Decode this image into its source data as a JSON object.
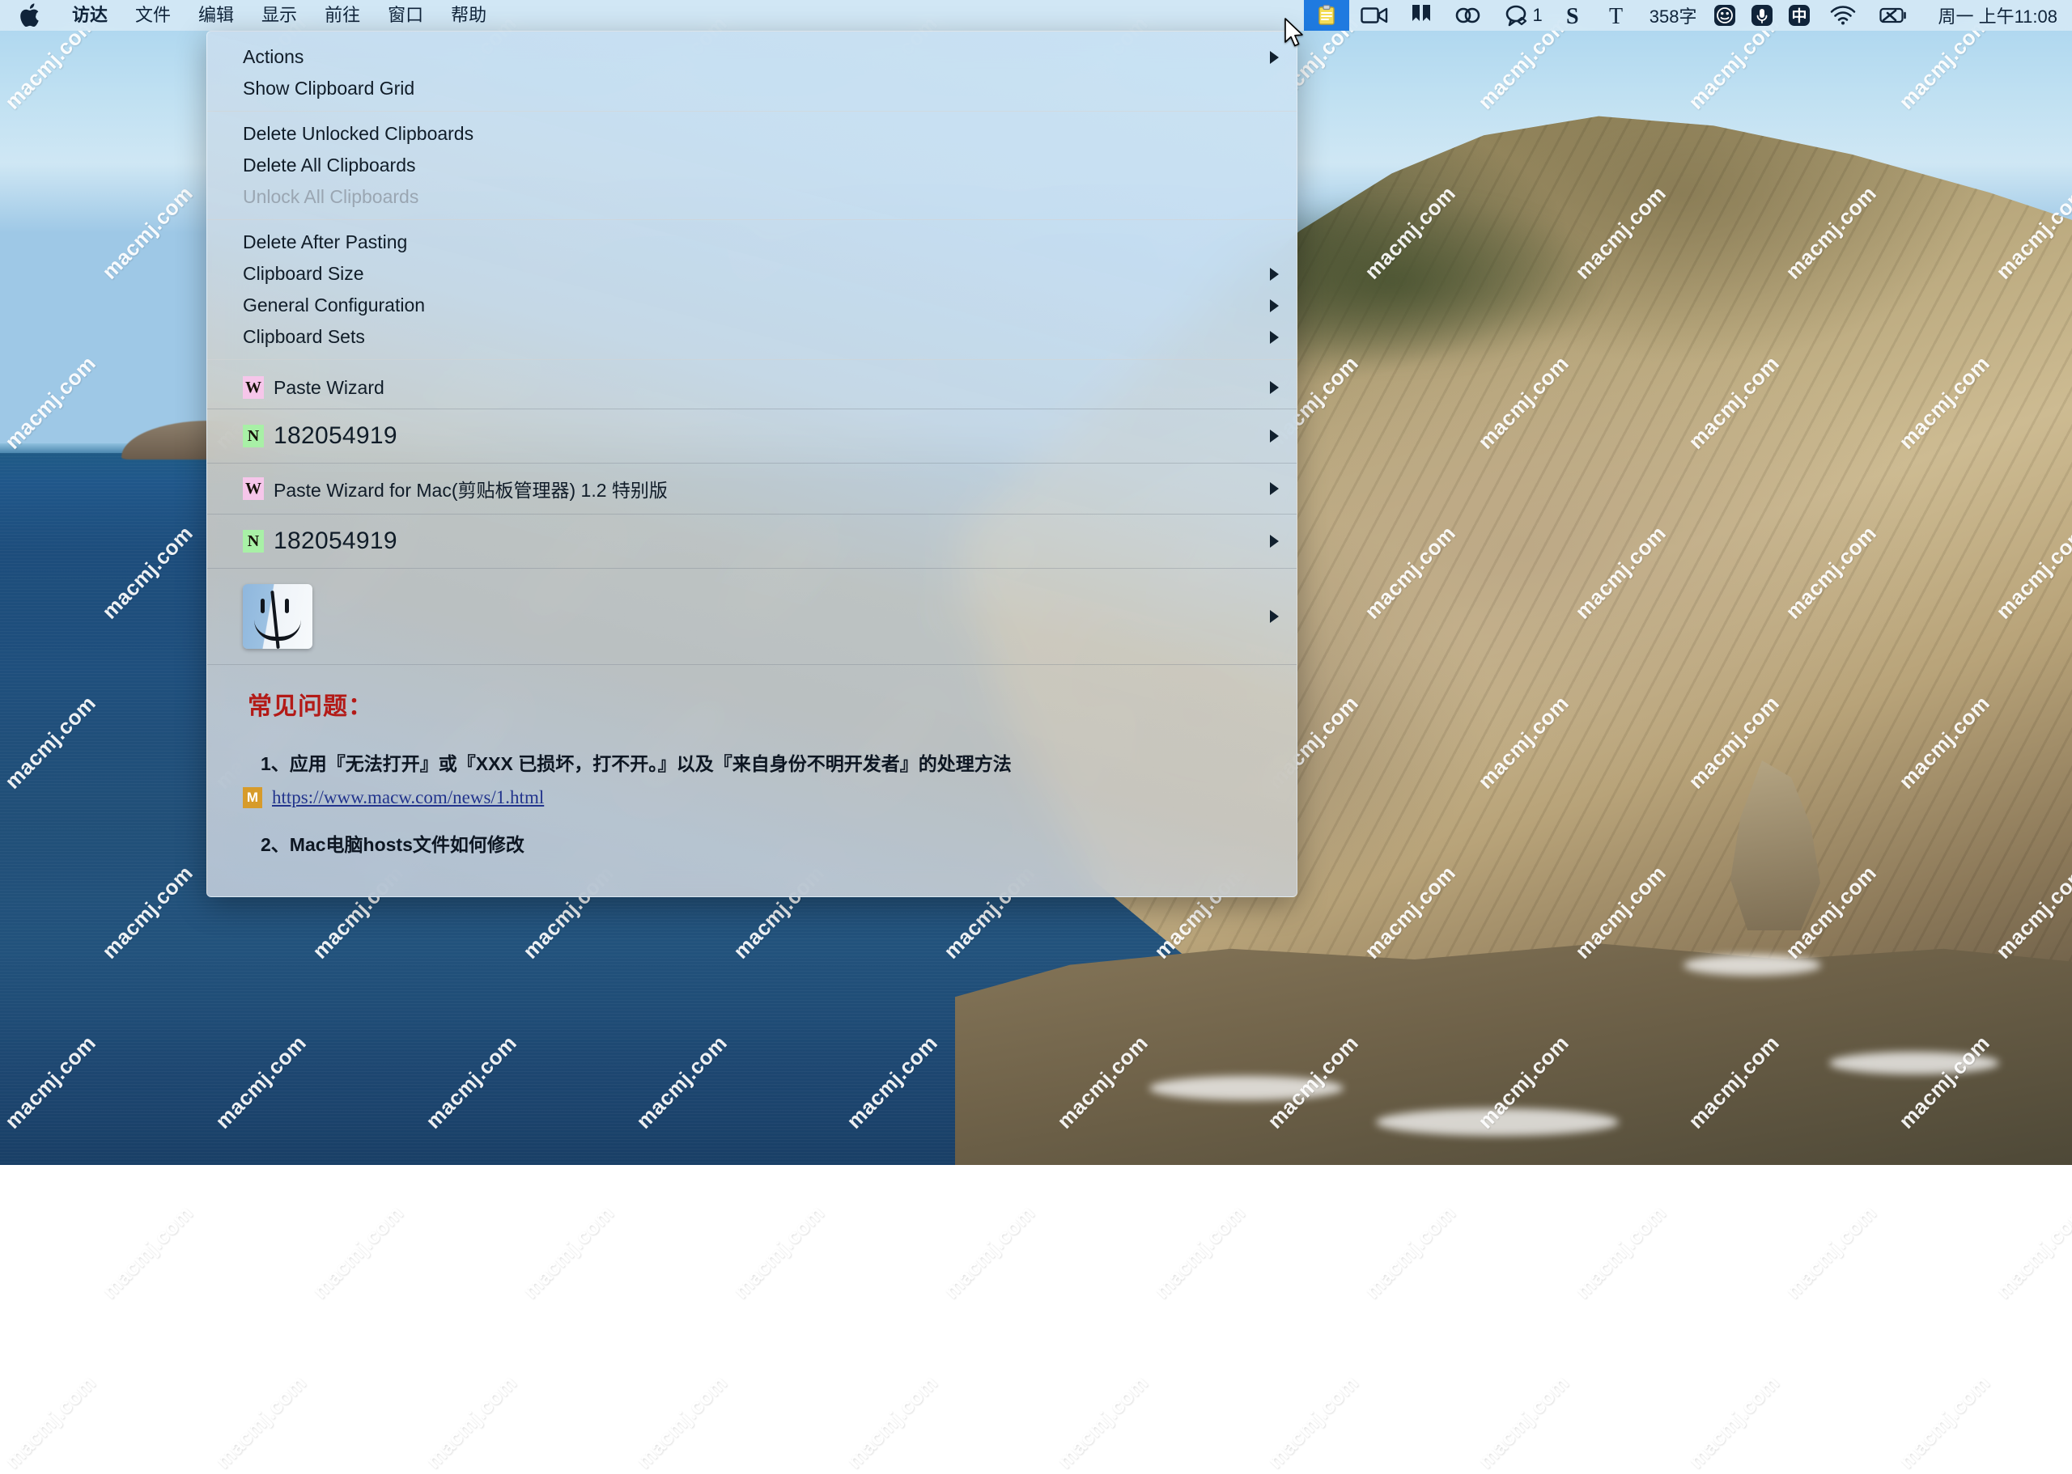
{
  "menubar": {
    "apple_icon": "apple-logo-icon",
    "items": [
      {
        "label": "访达",
        "bold": true
      },
      {
        "label": "文件",
        "bold": false
      },
      {
        "label": "编辑",
        "bold": false
      },
      {
        "label": "显示",
        "bold": false
      },
      {
        "label": "前往",
        "bold": false
      },
      {
        "label": "窗口",
        "bold": false
      },
      {
        "label": "帮助",
        "bold": false
      }
    ],
    "status_icons": [
      {
        "name": "clipboard-manager-icon",
        "glyph": "clipboard",
        "highlighted": true
      },
      {
        "name": "screen-recorder-icon",
        "glyph": "camcorder"
      },
      {
        "name": "bookmark-icon",
        "glyph": "bookmark"
      },
      {
        "name": "adobe-creative-cloud-icon",
        "glyph": "infinity"
      },
      {
        "name": "chat-icon",
        "glyph": "speech-bubble"
      },
      {
        "name": "sogou-input-icon",
        "glyph": "S"
      },
      {
        "name": "text-tool-icon",
        "glyph": "T"
      }
    ],
    "chat_badge": "1",
    "word_count": "358字",
    "emoji_icon": "emoji-icon",
    "mic_icon": "microphone-icon",
    "input_method": "中",
    "wifi_icon": "wifi-icon",
    "control_center_icon": "control-center-icon",
    "clock": "周一 上午11:08"
  },
  "menu": {
    "groups": [
      {
        "items": [
          {
            "label": "Actions",
            "arrow": true,
            "disabled": false
          },
          {
            "label": "Show Clipboard Grid",
            "arrow": false,
            "disabled": false
          }
        ]
      },
      {
        "items": [
          {
            "label": "Delete Unlocked Clipboards",
            "arrow": false,
            "disabled": false
          },
          {
            "label": "Delete All Clipboards",
            "arrow": false,
            "disabled": false
          },
          {
            "label": "Unlock All Clipboards",
            "arrow": false,
            "disabled": true
          }
        ]
      },
      {
        "items": [
          {
            "label": "Delete After Pasting",
            "arrow": false,
            "disabled": false
          },
          {
            "label": "Clipboard Size",
            "arrow": true,
            "disabled": false
          },
          {
            "label": "General Configuration",
            "arrow": true,
            "disabled": false
          },
          {
            "label": "Clipboard Sets",
            "arrow": true,
            "disabled": false
          }
        ]
      }
    ],
    "clips": [
      {
        "badge": "W",
        "badge_kind": "w",
        "label": "Paste Wizard",
        "arrow": true,
        "big": false
      },
      {
        "badge": "N",
        "badge_kind": "n",
        "label": "182054919",
        "arrow": true,
        "big": true
      },
      {
        "badge": "W",
        "badge_kind": "w",
        "label": "Paste Wizard for Mac(剪贴板管理器) 1.2 特别版",
        "arrow": true,
        "big": false
      },
      {
        "badge": "N",
        "badge_kind": "n",
        "label": "182054919",
        "arrow": true,
        "big": true
      }
    ],
    "finder_clip": {
      "icon": "finder-face-icon",
      "arrow": true
    },
    "faq": {
      "title": "常见问题：",
      "item1": "1、应用『无法打开』或『XXX 已损坏，打不开。』以及『来自身份不明开发者』的处理方法",
      "link_badge": "M",
      "link": "https://www.macw.com/news/1.html",
      "link_arrow": true,
      "item2": "2、Mac电脑hosts文件如何修改"
    }
  },
  "desktop": {
    "watermark_text": "macmj.com",
    "cursor": "arrow-cursor"
  },
  "colors": {
    "menubar_bg": "#d6e9f6",
    "menu_accent": "#1f7ae0",
    "faq_red": "#b31a17",
    "link_blue": "#22348c",
    "badge_w": "#f6c6ea",
    "badge_n": "#a8f0a6",
    "badge_m": "#d79b2a"
  }
}
